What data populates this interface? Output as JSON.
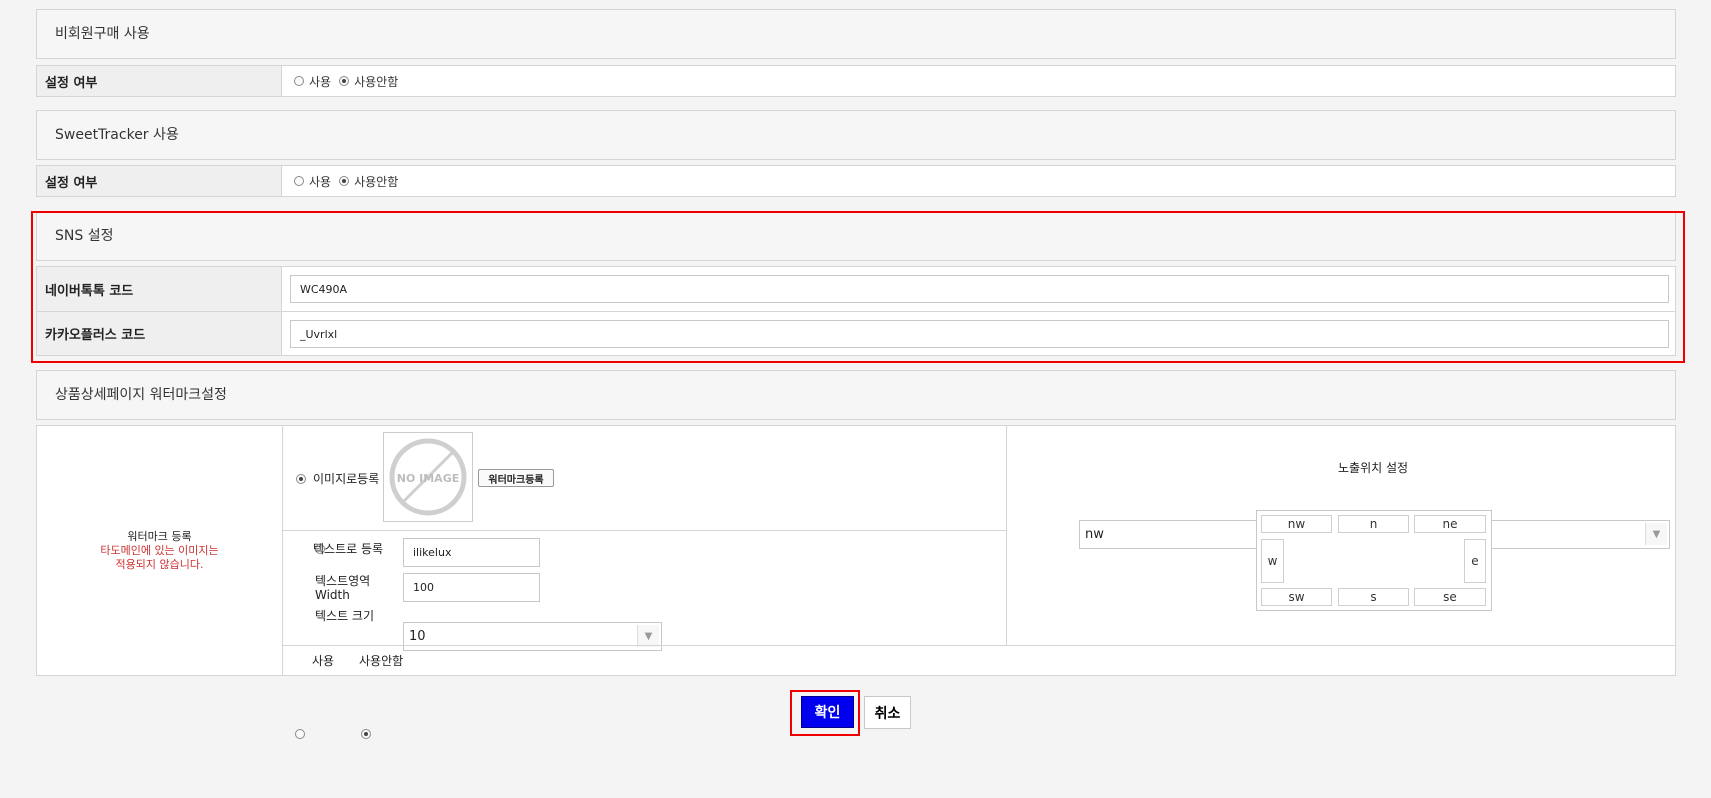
{
  "guest_purchase": {
    "title": "비회원구매 사용",
    "row_label": "설정 여부",
    "opt_use": "사용",
    "opt_not_use": "사용안함",
    "selected": "사용안함"
  },
  "sweettracker": {
    "title": "SweetTracker 사용",
    "row_label": "설정 여부",
    "opt_use": "사용",
    "opt_not_use": "사용안함",
    "selected": "사용안함"
  },
  "sns": {
    "title": "SNS 설정",
    "naver_label": "네이버톡톡 코드",
    "naver_value": "WC490A",
    "kakao_label": "카카오플러스 코드",
    "kakao_value": "_Uvrlxl"
  },
  "watermark": {
    "title": "상품상세페이지 워터마크설정",
    "left_label": "워터마크 등록",
    "left_note_1": "타도메인에 있는 이미지는",
    "left_note_2": "적용되지 않습니다.",
    "image_option": "이미지로등록",
    "no_image_text": "NO IMAGE",
    "register_button": "워터마크등록",
    "text_option": "텍스트로 등록",
    "text_value": "ilikelux",
    "width_label_1": "텍스트영역",
    "width_label_2": "Width",
    "width_value": "100",
    "size_label": "텍스트 크기",
    "size_value": "10",
    "position_label": "노출위치 설정",
    "position_value": "nw",
    "positions": {
      "nw": "nw",
      "n": "n",
      "ne": "ne",
      "w": "w",
      "e": "e",
      "sw": "sw",
      "s": "s",
      "se": "se"
    },
    "opt_use": "사용",
    "opt_not_use": "사용안함",
    "selected": "사용안함"
  },
  "buttons": {
    "confirm": "확인",
    "cancel": "취소"
  },
  "colors": {
    "highlight": "#ee0000",
    "confirm_bg": "#0000ee",
    "note_red": "#cc3333"
  }
}
